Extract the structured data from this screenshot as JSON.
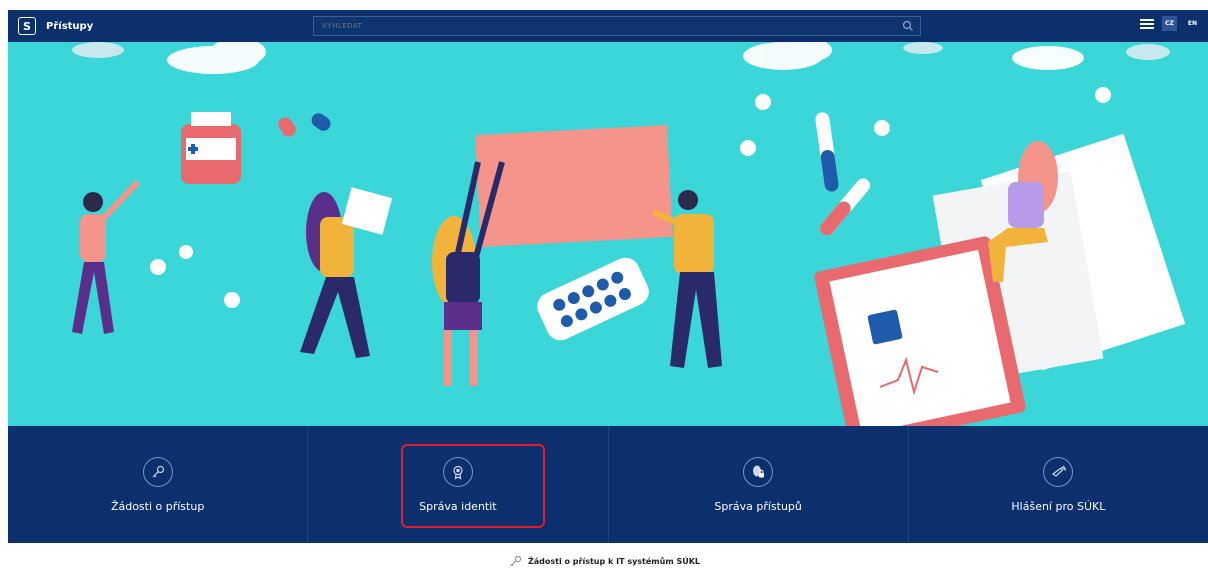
{
  "header": {
    "app_title": "Přístupy",
    "search_placeholder": "VYHLEDAT",
    "lang_cz": "CZ",
    "lang_en": "EN"
  },
  "tiles": [
    {
      "label": "Žádosti o přístup",
      "icon": "key-icon"
    },
    {
      "label": "Správa identit",
      "icon": "badge-icon"
    },
    {
      "label": "Správa přístupů",
      "icon": "fingerprint-lock-icon"
    },
    {
      "label": "Hlášení pro SÚKL",
      "icon": "megaphone-icon"
    }
  ],
  "footer": {
    "text": "Žádosti o přístup k IT systémům SÚKL",
    "icon": "key-icon"
  },
  "colors": {
    "navy": "#0c2f6e",
    "hero_bg": "#3ad6d8",
    "highlight": "#e01e2b"
  }
}
